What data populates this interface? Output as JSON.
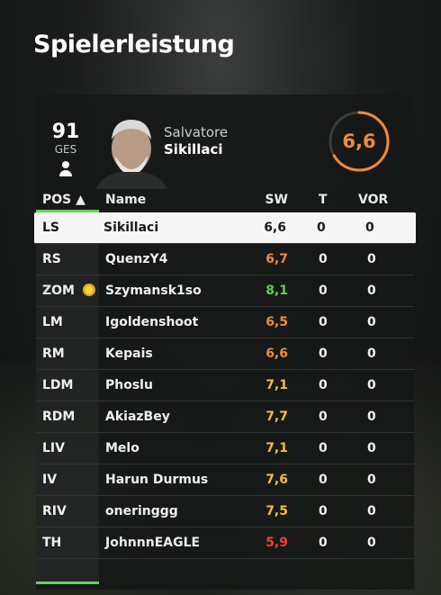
{
  "page": {
    "title": "Spielerleistung"
  },
  "player": {
    "rating": "91",
    "rating_label": "GES",
    "first_name": "Salvatore",
    "last_name": "Sikillaci",
    "score": "6,6",
    "score_color": "#f08a3a"
  },
  "table": {
    "headers": {
      "pos": "POS ▲",
      "name": "Name",
      "sw": "SW",
      "t": "T",
      "vor": "VOR"
    },
    "rows": [
      {
        "pos": "LS",
        "name": "Sikillaci",
        "sw": "6,6",
        "t": "0",
        "vor": "0",
        "sw_color": "#1a1a1a",
        "selected": true
      },
      {
        "pos": "RS",
        "name": "QuenzY4",
        "sw": "6,7",
        "t": "0",
        "vor": "0",
        "sw_color": "#f08a3a"
      },
      {
        "pos": "ZOM",
        "name": "Szymansk1so",
        "sw": "8,1",
        "t": "0",
        "vor": "0",
        "sw_color": "#5fcf4f",
        "star": true
      },
      {
        "pos": "LM",
        "name": "Igoldenshoot",
        "sw": "6,5",
        "t": "0",
        "vor": "0",
        "sw_color": "#f08a3a"
      },
      {
        "pos": "RM",
        "name": "Kepais",
        "sw": "6,6",
        "t": "0",
        "vor": "0",
        "sw_color": "#f08a3a"
      },
      {
        "pos": "LDM",
        "name": "Phoslu",
        "sw": "7,1",
        "t": "0",
        "vor": "0",
        "sw_color": "#f0c23a"
      },
      {
        "pos": "RDM",
        "name": "AkiazBey",
        "sw": "7,7",
        "t": "0",
        "vor": "0",
        "sw_color": "#f0c23a"
      },
      {
        "pos": "LIV",
        "name": "Melo",
        "sw": "7,1",
        "t": "0",
        "vor": "0",
        "sw_color": "#f0c23a"
      },
      {
        "pos": "IV",
        "name": "Harun Durmus",
        "sw": "7,6",
        "t": "0",
        "vor": "0",
        "sw_color": "#f0c23a"
      },
      {
        "pos": "RIV",
        "name": "oneringgg",
        "sw": "7,5",
        "t": "0",
        "vor": "0",
        "sw_color": "#f0c23a"
      },
      {
        "pos": "TH",
        "name": "JohnnnEAGLE",
        "sw": "5,9",
        "t": "0",
        "vor": "0",
        "sw_color": "#e8433a"
      }
    ]
  }
}
